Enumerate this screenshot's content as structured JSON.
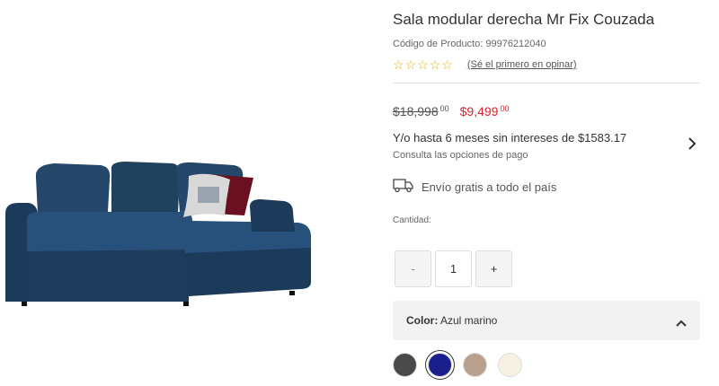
{
  "product": {
    "title": "Sala modular derecha Mr Fix Couzada",
    "code_label": "Código de Producto: 99976212040",
    "stars": [
      "☆",
      "☆",
      "☆",
      "☆",
      "☆"
    ],
    "review_link": "(Sé el primero en opinar)"
  },
  "pricing": {
    "old_price": "$18,998",
    "old_cents": "00",
    "new_price": "$9,499",
    "new_cents": "00",
    "accent_color": "#d9232e"
  },
  "financing": {
    "main_text": "Y/o hasta 6 meses sin intereses de $1583.17",
    "sub_text": "Consulta las opciones de pago"
  },
  "shipping": {
    "text": "Envío gratis a todo el país",
    "icon": "truck-icon"
  },
  "quantity": {
    "label": "Cantidad:",
    "minus": "-",
    "value": "1",
    "plus": "+"
  },
  "color": {
    "key_label": "Color:",
    "selected_value": "Azul marino",
    "swatches": [
      {
        "name": "gris oscuro",
        "hex": "#4a4a4a"
      },
      {
        "name": "azul marino",
        "hex": "#1b1f8c",
        "selected": true
      },
      {
        "name": "beige",
        "hex": "#b9a08c"
      },
      {
        "name": "crema",
        "hex": "#f7f1e4"
      }
    ]
  },
  "product_image": {
    "description_icon": "sofa-image",
    "upholstery_color": "#1f3d5c"
  }
}
